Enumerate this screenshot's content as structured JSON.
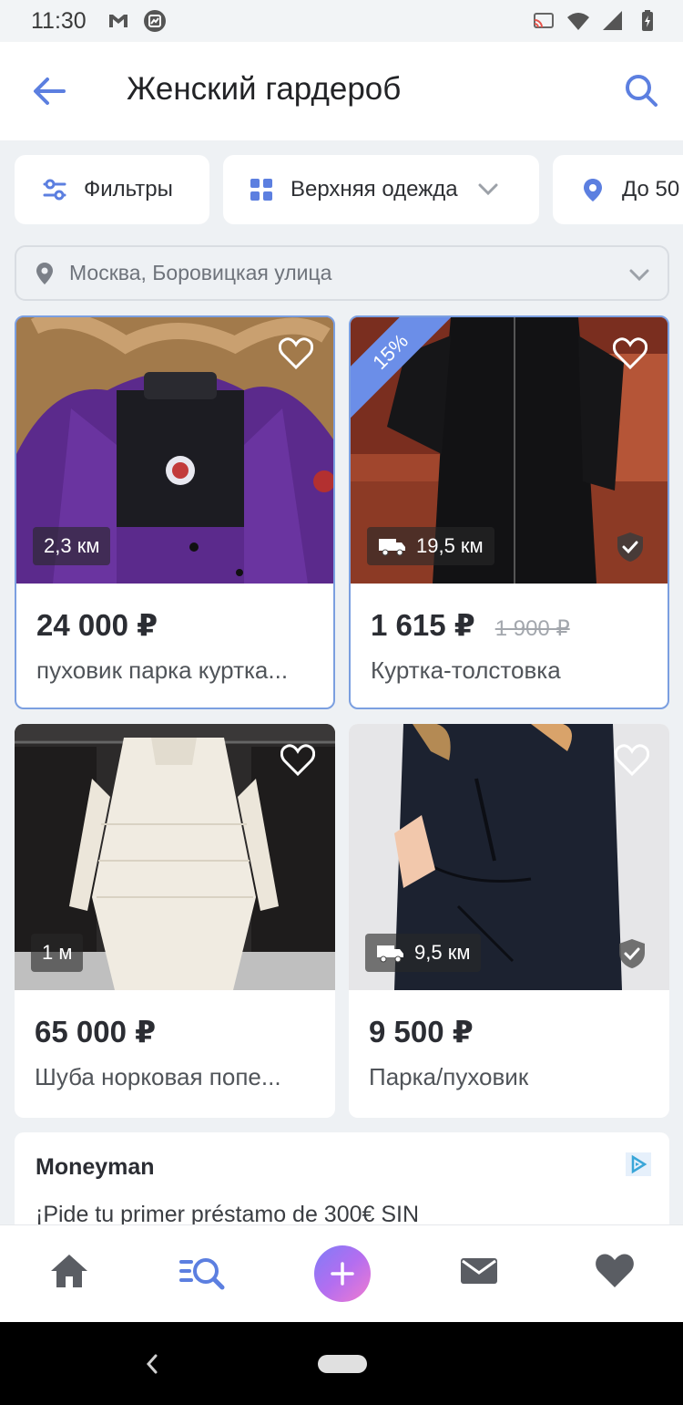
{
  "status_bar": {
    "time": "11:30"
  },
  "header": {
    "title": "Женский гардероб"
  },
  "chips": {
    "filters_label": "Фильтры",
    "category_label": "Верхняя одежда",
    "distance_label": "До 50"
  },
  "location": {
    "value": "Москва, Боровицкая улица"
  },
  "listings": [
    {
      "price": "24 000 ₽",
      "title": "пуховик парка куртка...",
      "distance": "2,3 км"
    },
    {
      "price": "1 615 ₽",
      "old_price": "1 900 ₽",
      "title": "Куртка-толстовка",
      "distance": "19,5 км",
      "discount": "15%"
    },
    {
      "price": "65 000 ₽",
      "title": "Шуба норковая попе...",
      "distance": "1 м"
    },
    {
      "price": "9 500 ₽",
      "title": "Парка/пуховик",
      "distance": "9,5 км"
    }
  ],
  "ad": {
    "title": "Moneyman",
    "text": "¡Pide tu primer préstamo de 300€ SIN"
  },
  "bottom_nav": {
    "items": [
      "home-icon",
      "search-list-icon",
      "add-icon",
      "mail-icon",
      "heart-icon"
    ],
    "active_color": "#5c7fe0",
    "inactive_color": "#5a5d63"
  },
  "colors": {
    "accent": "#5c7fe0",
    "sale": "#6b8ee8"
  }
}
